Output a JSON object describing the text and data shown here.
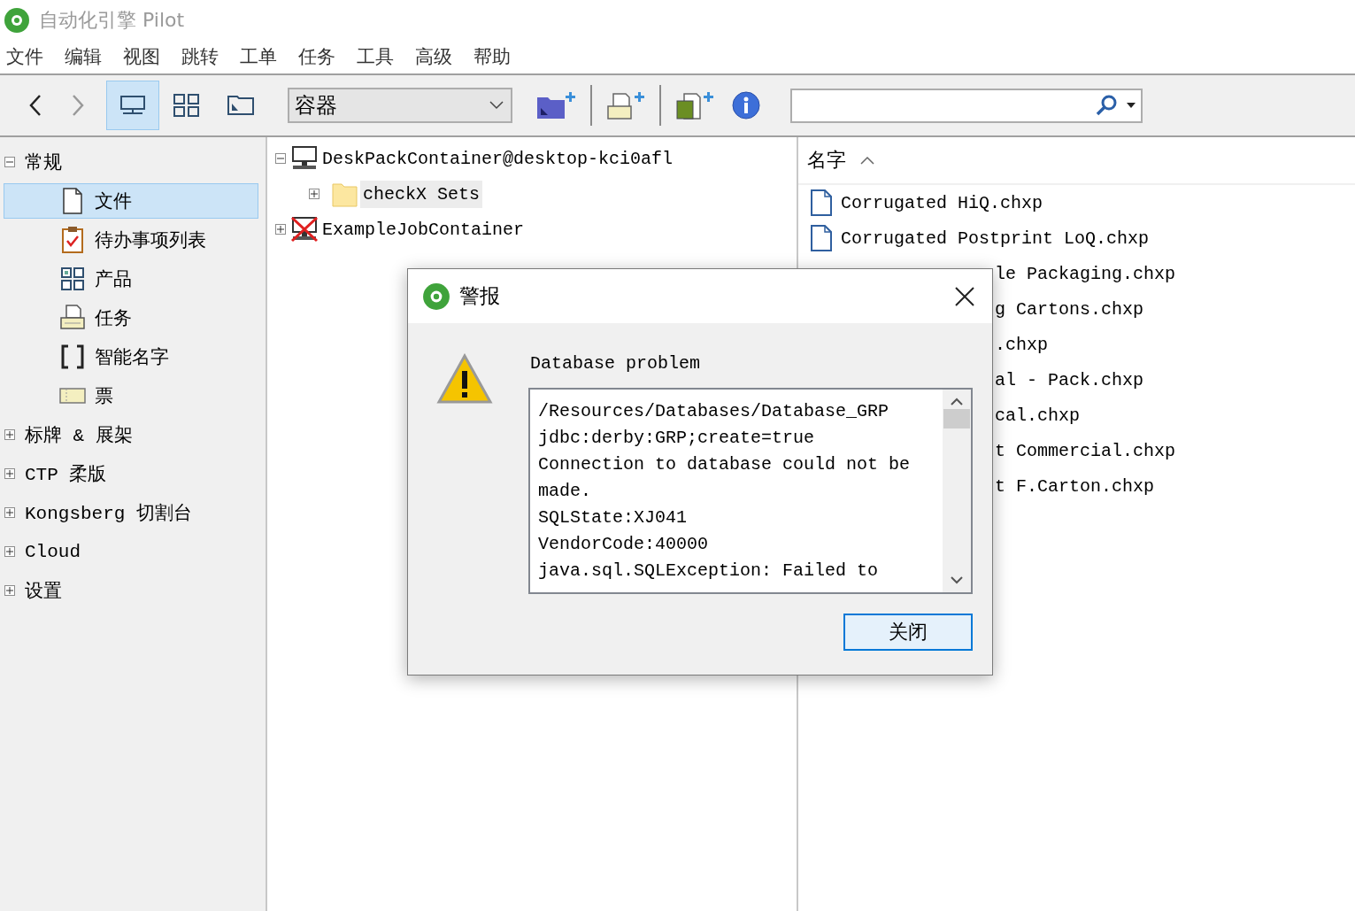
{
  "window": {
    "title": "自动化引擎 Pilot"
  },
  "menu": [
    "文件",
    "编辑",
    "视图",
    "跳转",
    "工单",
    "任务",
    "工具",
    "高级",
    "帮助"
  ],
  "toolbar": {
    "view_buttons": [
      {
        "kind": "monitor",
        "selected": true
      },
      {
        "kind": "grid",
        "selected": false
      },
      {
        "kind": "window",
        "selected": false
      }
    ],
    "combo": {
      "value": "容器"
    }
  },
  "sidebar": {
    "items": [
      {
        "label": "常规",
        "expanded": true,
        "selected": false,
        "children": [
          {
            "label": "文件",
            "kind": "file",
            "selected": true
          },
          {
            "label": "待办事项列表",
            "kind": "checklist",
            "selected": false
          },
          {
            "label": "产品",
            "kind": "product",
            "selected": false
          },
          {
            "label": "任务",
            "kind": "task",
            "selected": false
          },
          {
            "label": "智能名字",
            "kind": "smartname",
            "selected": false
          },
          {
            "label": "票",
            "kind": "ticket",
            "selected": false
          }
        ]
      },
      {
        "label": "标牌 & 展架",
        "expanded": false,
        "selected": false
      },
      {
        "label": "CTP 柔版",
        "expanded": false,
        "selected": false
      },
      {
        "label": "Kongsberg 切割台",
        "expanded": false,
        "selected": false
      },
      {
        "label": "Cloud",
        "expanded": false,
        "selected": false
      },
      {
        "label": "设置",
        "expanded": false,
        "selected": false
      }
    ]
  },
  "tree": {
    "items": [
      {
        "label": "DeskPackContainer@desktop-kci0afl",
        "kind": "server",
        "expanded": true,
        "selected": false,
        "children": [
          {
            "label": "checkX Sets",
            "kind": "folder",
            "expanded": false,
            "selected": true
          }
        ]
      },
      {
        "label": "ExampleJobContainer",
        "kind": "server-offline",
        "expanded": false,
        "selected": false
      }
    ]
  },
  "file_list": {
    "column": "名字",
    "rows": [
      {
        "name": "Corrugated HiQ.chxp",
        "covered": false
      },
      {
        "name": "Corrugated Postprint LoQ.chxp",
        "covered": false
      },
      {
        "name": "le Packaging.chxp",
        "covered": true
      },
      {
        "name": "g Cartons.chxp",
        "covered": true
      },
      {
        "name": ".chxp",
        "covered": true
      },
      {
        "name": "al - Pack.chxp",
        "covered": true
      },
      {
        "name": "cal.chxp",
        "covered": true
      },
      {
        "name": "t Commercial.chxp",
        "covered": true
      },
      {
        "name": "t F.Carton.chxp",
        "covered": true
      }
    ]
  },
  "dialog": {
    "title": "警报",
    "heading": "Database problem",
    "message_lines": [
      "/Resources/Databases/Database_GRP",
      "jdbc:derby:GRP;create=true",
      "Connection to database could not be",
      "made.",
      "SQLState:XJ041",
      "VendorCode:40000",
      "java.sql.SQLException: Failed to"
    ],
    "button": "关闭"
  }
}
